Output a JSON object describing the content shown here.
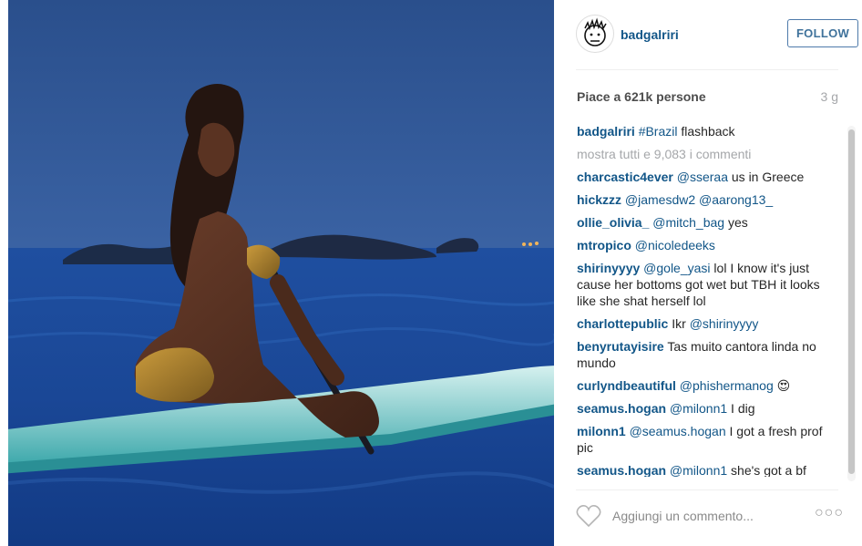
{
  "post": {
    "username": "badgalriri",
    "follow_label": "FOLLOW",
    "likes": "Piace a 621k persone",
    "time_ago": "3 g"
  },
  "caption": {
    "user": "badgalriri",
    "hashtag": "#Brazil",
    "text": " flashback"
  },
  "show_all_comments": "mostra tutti e 9,083 i commenti",
  "comments": [
    {
      "user": "charcastic4ever",
      "mention": "@sseraa",
      "text": " us in Greece"
    },
    {
      "user": "hickzzz",
      "mention": "@jamesdw2 @aarong13_",
      "text": ""
    },
    {
      "user": "ollie_olivia_",
      "mention": "@mitch_bag",
      "text": " yes"
    },
    {
      "user": "mtropico",
      "mention": "@nicoledeeks",
      "text": ""
    },
    {
      "user": "shirinyyyy",
      "mention": "@gole_yasi",
      "text": " lol I know it's just cause her bottoms got wet but TBH it looks like she shat herself lol"
    },
    {
      "user": "charlottepublic",
      "mention": "",
      "text": "Ikr ",
      "mention2": "@shirinyyyy"
    },
    {
      "user": "benyrutayisire",
      "mention": "",
      "text": "Tas muito cantora linda no mundo"
    },
    {
      "user": "curlyndbeautiful",
      "mention": "@phishermanog",
      "text": " 😍"
    },
    {
      "user": "seamus.hogan",
      "mention": "@milonn1",
      "text": " I dig"
    },
    {
      "user": "milonn1",
      "mention": "@seamus.hogan",
      "text": " I got a fresh prof pic"
    },
    {
      "user": "seamus.hogan",
      "mention": "@milonn1",
      "text": " she's got a bf chill"
    }
  ],
  "footer": {
    "heart_icon": "heart-outline-icon",
    "comment_placeholder": "Aggiungi un commento...",
    "more_label": "○○○"
  },
  "colors": {
    "link": "#125688",
    "follow_border": "#4e7aaa",
    "muted": "#a5a7aa"
  }
}
